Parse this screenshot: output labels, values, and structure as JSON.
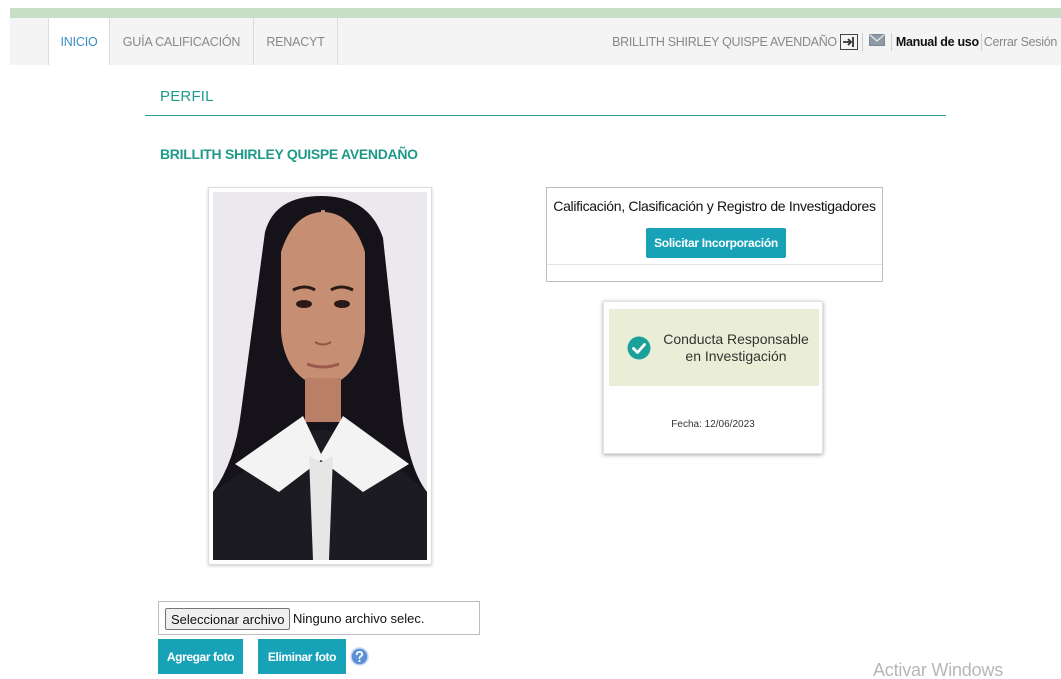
{
  "nav": {
    "tabs": [
      {
        "label": "INICIO",
        "active": true
      },
      {
        "label": "GUÍA CALIFICACIÓN",
        "active": false
      },
      {
        "label": "RENACYT",
        "active": false
      }
    ],
    "user_name": "BRILLITH SHIRLEY QUISPE AVENDAÑO",
    "manual_prefix": "Manual",
    "manual_rest": " de uso",
    "logout": "Cerrar Sesión",
    "icons": [
      "switch-account-icon",
      "mail-icon"
    ]
  },
  "profile": {
    "section_title": "PERFIL",
    "name": "BRILLITH SHIRLEY QUISPE AVENDAÑO"
  },
  "calificacion_card": {
    "title": "Calificación, Clasificación y Registro de Investigadores",
    "button": "Solicitar Incorporación"
  },
  "conducta_card": {
    "line1": "Conducta Responsable",
    "line2": "en Investigación",
    "fecha": "Fecha: 12/06/2023",
    "icon": "check-circle-icon"
  },
  "upload": {
    "choose_file_button": "Seleccionar archivo",
    "status": "Ninguno archivo selec.",
    "add_button": "Agregar foto",
    "delete_button": "Eliminar foto",
    "help_icon": "help-icon"
  },
  "watermark": "Activar Windows",
  "colors": {
    "accent": "#17a2b8",
    "heading": "#1f9a8a",
    "active_tab": "#3c8fc5",
    "badge_bg": "#ebeed6",
    "check": "#1aa19a"
  }
}
